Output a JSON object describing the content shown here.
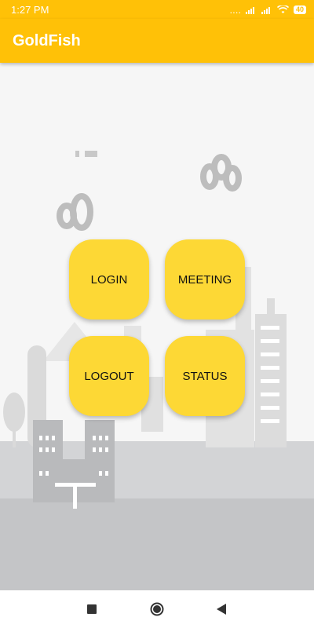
{
  "status_bar": {
    "time": "1:27 PM",
    "signal_text": "....",
    "battery": "40"
  },
  "app_bar": {
    "title": "GoldFish"
  },
  "menu": {
    "login": "LOGIN",
    "meeting": "MEETING",
    "logout": "LOGOUT",
    "status": "STATUS"
  },
  "nav": {
    "icons": [
      "recent-apps-icon",
      "home-icon",
      "back-icon"
    ]
  },
  "colors": {
    "accent": "#ffc107",
    "tile": "#fdd835"
  }
}
